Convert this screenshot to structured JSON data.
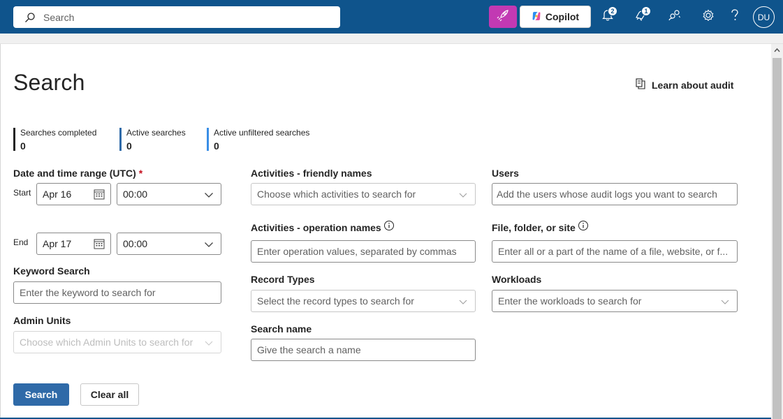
{
  "topbar": {
    "search_placeholder": "Search",
    "copilot_label": "Copilot",
    "notifications_count": "2",
    "alerts_count": "1",
    "avatar_initials": "DU",
    "bar_color": "#0f548c",
    "rocket_color": "#c239b3",
    "icons": [
      "search-icon",
      "rocket-icon",
      "copilot-logo-icon",
      "bell-icon",
      "megaphone-icon",
      "people-icon",
      "gear-icon",
      "help-icon"
    ]
  },
  "page": {
    "title": "Search",
    "learn_link": "Learn about audit"
  },
  "stats": [
    {
      "label": "Searches completed",
      "value": "0",
      "color": "#242424"
    },
    {
      "label": "Active searches",
      "value": "0",
      "color": "#2f6aa8"
    },
    {
      "label": "Active unfiltered searches",
      "value": "0",
      "color": "#3a8ee6"
    }
  ],
  "form": {
    "date_range": {
      "label": "Date and time range (UTC)",
      "required_mark": "*",
      "start_label": "Start",
      "start_date": "Apr 16",
      "start_time": "00:00",
      "end_label": "End",
      "end_date": "Apr 17",
      "end_time": "00:00"
    },
    "keyword": {
      "label": "Keyword Search",
      "placeholder": "Enter the keyword to search for"
    },
    "admin_units": {
      "label": "Admin Units",
      "placeholder": "Choose which Admin Units to search for"
    },
    "activities_friendly": {
      "label": "Activities - friendly names",
      "placeholder": "Choose which activities to search for"
    },
    "activities_operation": {
      "label": "Activities - operation names",
      "placeholder": "Enter operation values, separated by commas"
    },
    "record_types": {
      "label": "Record Types",
      "placeholder": "Select the record types to search for"
    },
    "search_name": {
      "label": "Search name",
      "placeholder": "Give the search a name"
    },
    "users": {
      "label": "Users",
      "placeholder": "Add the users whose audit logs you want to search"
    },
    "file_folder": {
      "label": "File, folder, or site",
      "placeholder": "Enter all or a part of the name of a file, website, or f..."
    },
    "workloads": {
      "label": "Workloads",
      "placeholder": "Enter the workloads to search for"
    }
  },
  "actions": {
    "search_button": "Search",
    "clear_button": "Clear all",
    "primary_color": "#2f6aa8"
  }
}
